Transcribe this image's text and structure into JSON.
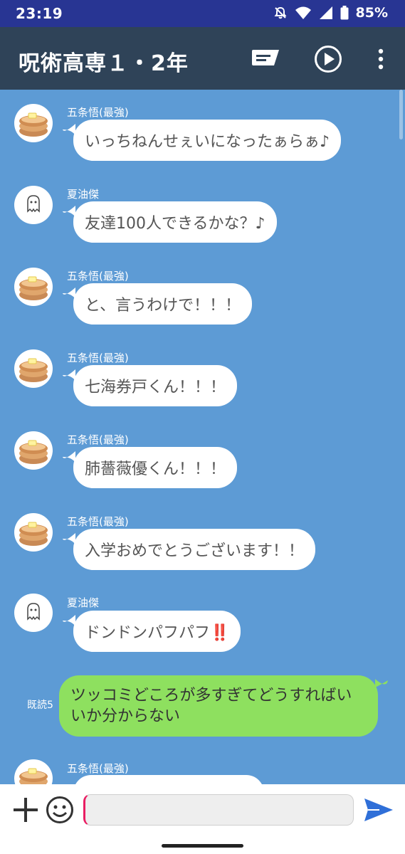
{
  "status": {
    "time": "23:19",
    "battery": "85%",
    "icons": [
      "bell-off-icon",
      "wifi-icon",
      "signal-icon",
      "battery-icon"
    ]
  },
  "header": {
    "title": "呪術高専１・2年",
    "icons": [
      "message-icon",
      "play-icon",
      "more-icon"
    ]
  },
  "messages": [
    {
      "sender": "五条悟(最強)",
      "text": "いっちねんせぇいになったぁらぁ♪",
      "avatar": "pancake-avatar"
    },
    {
      "sender": "夏油傑",
      "text": "友達100人できるかな？♪",
      "avatar": "ghost-avatar"
    },
    {
      "sender": "五条悟(最強)",
      "text": "と、言うわけで！！！",
      "avatar": "pancake-avatar"
    },
    {
      "sender": "五条悟(最強)",
      "text": "七海券戸くん！！！",
      "avatar": "pancake-avatar"
    },
    {
      "sender": "五条悟(最強)",
      "text": "肺薔薇優くん！！！",
      "avatar": "pancake-avatar"
    },
    {
      "sender": "五条悟(最強)",
      "text": "入学おめでとうございます！！",
      "avatar": "pancake-avatar"
    },
    {
      "sender": "夏油傑",
      "text": "ドンドンパフパフ‼️",
      "avatar": "ghost-avatar"
    }
  ],
  "outgoing": {
    "read": "既読5",
    "text": "ツッコミどころが多すぎてどうすればいいか分からない"
  },
  "last_partial": {
    "sender": "五条悟(最強)",
    "avatar": "pancake-avatar"
  },
  "input": {
    "value": "",
    "placeholder": ""
  },
  "colors": {
    "status_bar": "#283593",
    "app_bar": "#2f4358",
    "chat_bg": "#5d9bd5",
    "incoming_bubble": "#ffffff",
    "outgoing_bubble": "#8ee05f",
    "send_icon": "#2f6fd8"
  }
}
